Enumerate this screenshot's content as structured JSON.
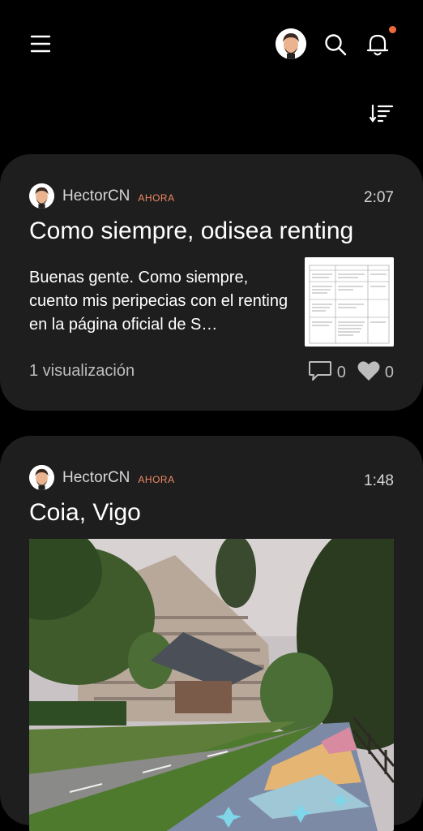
{
  "header": {
    "menu_icon": "hamburger-menu-icon",
    "search_icon": "search-icon",
    "bell_icon": "bell-icon",
    "sort_icon": "sort-icon",
    "notification_color": "#ef6a3a"
  },
  "posts": [
    {
      "author": "HectorCN",
      "badge": "AHORA",
      "time": "2:07",
      "title": "Como siempre, odisea renting",
      "excerpt": "Buenas gente. Como siempre, cuento mis peripecias con el renting en la página oficial de S…",
      "views": "1 visualización",
      "comments": "0",
      "likes": "0"
    },
    {
      "author": "HectorCN",
      "badge": "AHORA",
      "time": "1:48",
      "title": "Coia, Vigo"
    }
  ],
  "colors": {
    "background": "#000000",
    "card": "#1e1e1f",
    "badge": "#ef8a62"
  }
}
